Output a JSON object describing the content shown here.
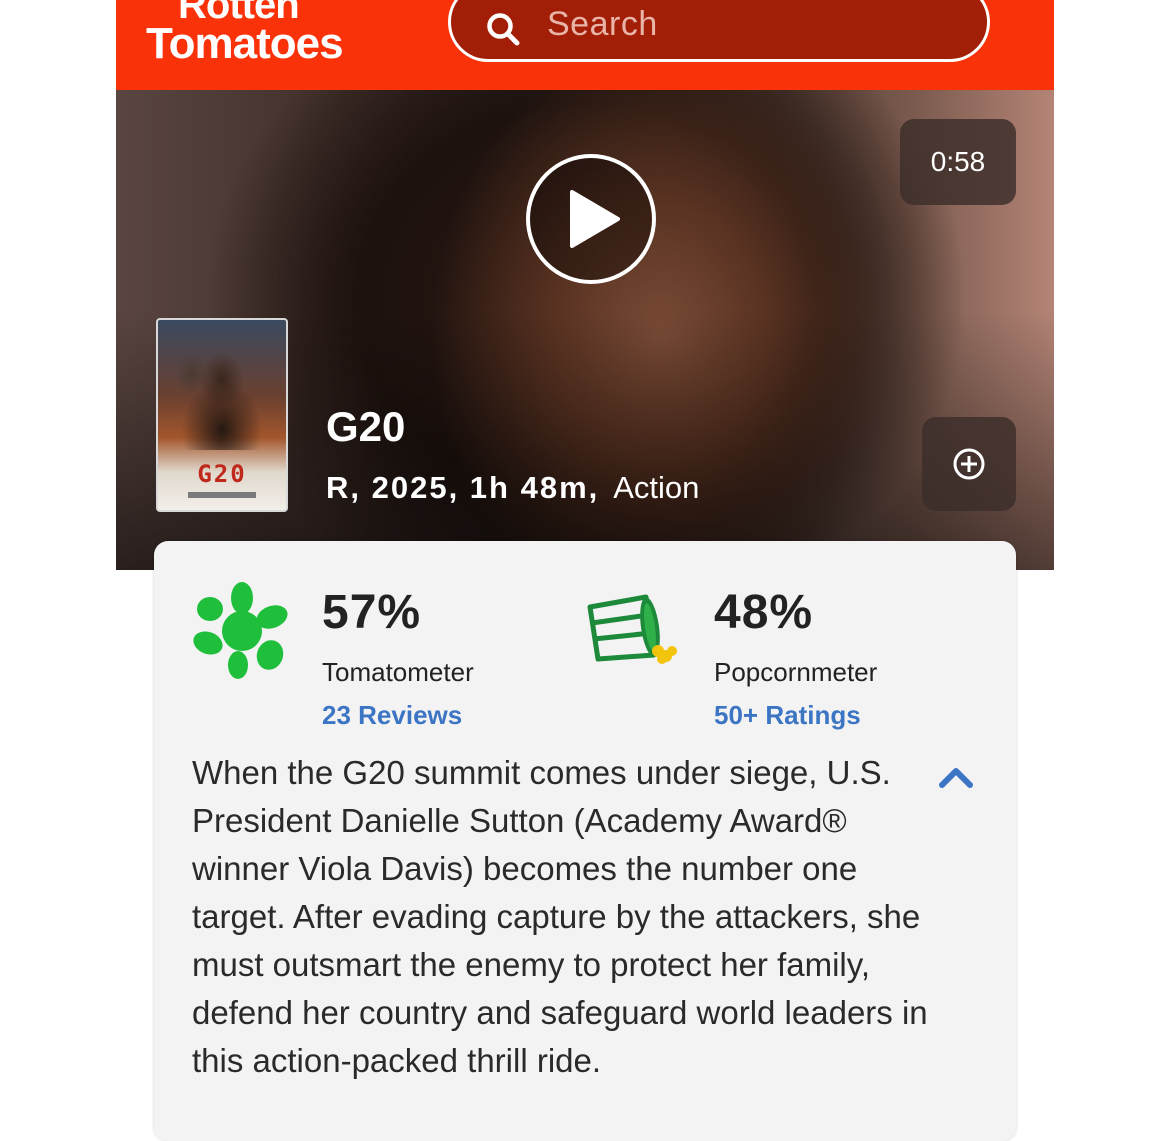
{
  "header": {
    "logo_line1": "Rotten",
    "logo_line2": "Tomatoes",
    "search_placeholder": "Search"
  },
  "hero": {
    "duration": "0:58",
    "title": "G20",
    "meta_bold": "R, 2025, 1h 48m,",
    "genre": "Action",
    "poster_title": "G20"
  },
  "scores": {
    "tomatometer": {
      "value": "57%",
      "label": "Tomatometer",
      "link": "23 Reviews"
    },
    "popcornmeter": {
      "value": "48%",
      "label": "Popcornmeter",
      "link": "50+ Ratings"
    }
  },
  "synopsis": "When the G20 summit comes under siege, U.S. President Danielle Sutton (Academy Award® winner Viola Davis) becomes the number one target. After evading capture by the attackers, she must outsmart the enemy to protect her family, defend her country and safeguard world leaders in this action-packed thrill ride.",
  "colors": {
    "brand": "#fa320a",
    "tomatometer_splat": "#1fbf3c",
    "link": "#3c75c4"
  },
  "icons": {
    "search": "search-icon",
    "play": "play-icon",
    "add": "add-circle-icon",
    "tomatometer": "rotten-splat-icon",
    "popcornmeter": "tipped-bucket-icon",
    "collapse": "chevron-up-icon"
  }
}
